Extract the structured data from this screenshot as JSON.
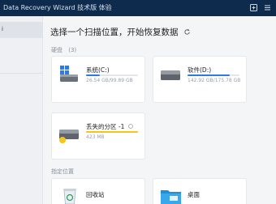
{
  "titlebar": {
    "title": "Data Recovery Wizard 技术版 体验",
    "icons": [
      "help-icon",
      "menu-icon"
    ]
  },
  "sidebar": {
    "items": [
      {
        "label": "i",
        "active": true
      },
      {
        "label": "",
        "active": false
      }
    ]
  },
  "main": {
    "heading": "选择一个扫描位置，开始恢复数据",
    "drives_label": "硬盘",
    "drives_count": "(3)",
    "drives": [
      {
        "name": "系统(C:)",
        "size": "26.54 GB/99.89 GB",
        "usage": 0.27,
        "fill_color": "#2c7be5",
        "icon": "windows-drive-icon"
      },
      {
        "name": "软件(D:)",
        "size": "142.92 GB/175.78 GB",
        "usage": 0.81,
        "fill_color": "#2c7be5",
        "icon": "drive-icon"
      },
      {
        "name": "丢失的分区 -1",
        "size": "423 MB",
        "usage": 1.0,
        "fill_color": "#f5c518",
        "icon": "lost-partition-drive-icon"
      }
    ],
    "locations_label": "指定位置",
    "locations": [
      {
        "name": "回收站",
        "icon": "recycle-bin-icon"
      },
      {
        "name": "桌面",
        "icon": "desktop-folder-icon"
      }
    ]
  }
}
